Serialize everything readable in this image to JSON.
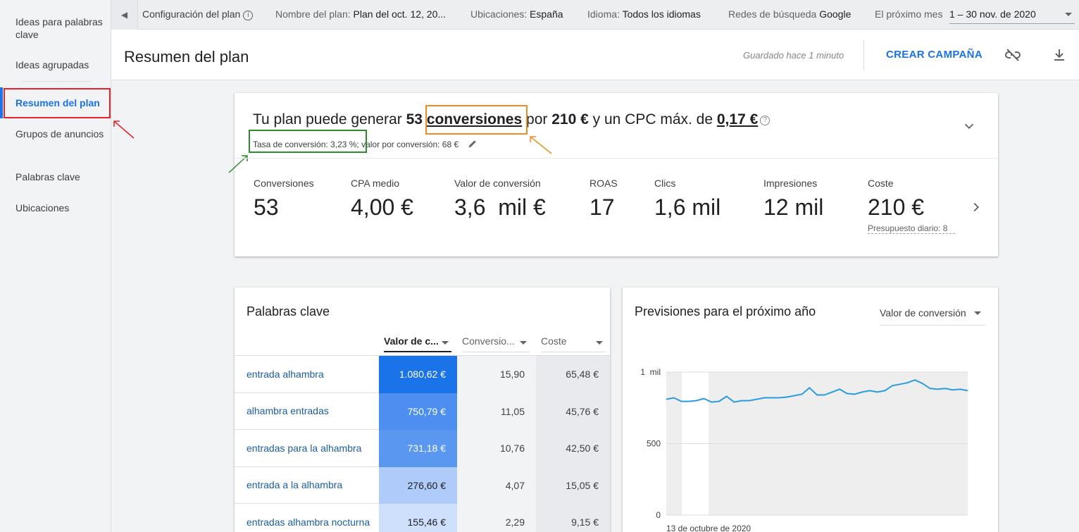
{
  "sidebar": {
    "items": [
      {
        "label": "Ideas para palabras clave"
      },
      {
        "label": "Ideas agrupadas"
      },
      {
        "label": "Resumen del plan",
        "active": true
      },
      {
        "label": "Grupos de anuncios"
      },
      {
        "label": "Palabras clave"
      },
      {
        "label": "Ubicaciones"
      }
    ]
  },
  "topbar": {
    "config_label": "Configuración del plan",
    "plan_name_label": "Nombre del plan:",
    "plan_name_value": "Plan del oct. 12, 20...",
    "locations_label": "Ubicaciones:",
    "locations_value": "España",
    "language_label": "Idioma:",
    "language_value": "Todos los idiomas",
    "networks_label": "Redes de búsqueda",
    "networks_value": "Google",
    "period_label": "El próximo mes",
    "period_value": "1 – 30 nov. de 2020"
  },
  "header": {
    "title": "Resumen del plan",
    "saved_text": "Guardado hace 1 minuto",
    "create_campaign": "CREAR CAMPAÑA"
  },
  "summary": {
    "intro": "Tu plan puede generar",
    "conversions_num": "53",
    "conversions_word": "conversiones",
    "for_word": "por",
    "cost": "210 €",
    "cpc_text": "y un CPC máx. de",
    "cpc_value": "0,17 €",
    "sub_text": "Tasa de conversión: 3,23 %; valor por conversión: 68 €",
    "metrics": [
      {
        "label": "Conversiones",
        "value": "53"
      },
      {
        "label": "CPA medio",
        "value": "4,00 €"
      },
      {
        "label": "Valor de conversión",
        "value": "3,6  mil €"
      },
      {
        "label": "ROAS",
        "value": "17"
      },
      {
        "label": "Clics",
        "value": "1,6 mil"
      },
      {
        "label": "Impresiones",
        "value": "12 mil"
      },
      {
        "label": "Coste",
        "value": "210 €",
        "note": "Presupuesto diario: 8"
      }
    ]
  },
  "keywords": {
    "title": "Palabras clave",
    "columns": [
      "Valor de c...",
      "Conversio...",
      "Coste"
    ],
    "rows": [
      {
        "keyword": "entrada alhambra",
        "value": "1.080,62 €",
        "conv": "15,90",
        "cost": "65,48 €",
        "shade": "#1a73e8",
        "text_color": "#ffffff"
      },
      {
        "keyword": "alhambra entradas",
        "value": "750,79 €",
        "conv": "11,05",
        "cost": "45,76 €",
        "shade": "#4c8ff0",
        "text_color": "#ffffff"
      },
      {
        "keyword": "entradas para la alhambra",
        "value": "731,18 €",
        "conv": "10,76",
        "cost": "42,50 €",
        "shade": "#5a97f1",
        "text_color": "#ffffff"
      },
      {
        "keyword": "entrada a la alhambra",
        "value": "276,60 €",
        "conv": "4,07",
        "cost": "15,05 €",
        "shade": "#aecbfa",
        "text_color": "#202124"
      },
      {
        "keyword": "entradas alhambra nocturna",
        "value": "155,46 €",
        "conv": "2,29",
        "cost": "9,15 €",
        "shade": "#cfe0fc",
        "text_color": "#202124"
      }
    ]
  },
  "forecast": {
    "title": "Previsiones para el próximo año",
    "metric_select": "Valor de conversión",
    "date_label": "13 de octubre de 2020"
  },
  "chart_data": {
    "type": "line",
    "title": "Previsiones para el próximo año",
    "xlabel": "",
    "ylabel": "",
    "x_start_label": "13 de octubre de 2020",
    "y_ticks": [
      "0",
      "500",
      "1  mil"
    ],
    "ylim": [
      0,
      1000
    ],
    "grid": true,
    "series": [
      {
        "values": [
          810,
          820,
          795,
          795,
          800,
          815,
          790,
          795,
          830,
          790,
          800,
          800,
          810,
          820,
          820,
          820,
          825,
          835,
          845,
          890,
          840,
          840,
          860,
          880,
          850,
          845,
          860,
          870,
          860,
          870,
          905,
          915,
          925,
          945,
          920,
          885,
          880,
          885,
          875,
          880,
          870
        ]
      }
    ]
  }
}
